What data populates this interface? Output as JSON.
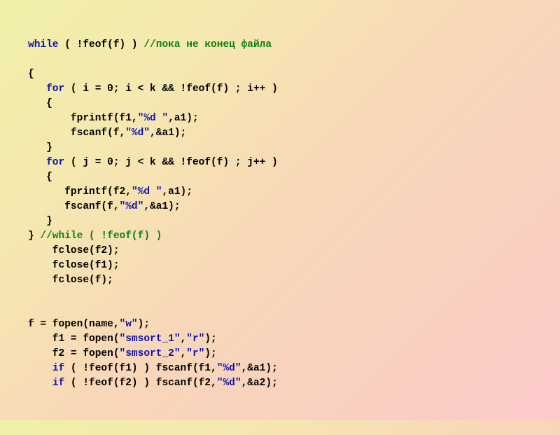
{
  "code_segments": [
    {
      "type": "kw",
      "text": "while"
    },
    {
      "type": "plain",
      "text": " ( !feof(f) ) "
    },
    {
      "type": "cmt",
      "text": "//пока не конец файла"
    },
    {
      "type": "plain",
      "text": "\n\n{\n   "
    },
    {
      "type": "kw",
      "text": "for"
    },
    {
      "type": "plain",
      "text": " ( i = 0; i < k && !feof(f) ; i++ )\n   {\n       fprintf(f1,"
    },
    {
      "type": "str",
      "text": "\"%d \""
    },
    {
      "type": "plain",
      "text": ",a1);\n       fscanf(f,"
    },
    {
      "type": "str",
      "text": "\"%d\""
    },
    {
      "type": "plain",
      "text": ",&a1);\n   }\n   "
    },
    {
      "type": "kw",
      "text": "for"
    },
    {
      "type": "plain",
      "text": " ( j = 0; j < k && !feof(f) ; j++ )\n   {\n      fprintf(f2,"
    },
    {
      "type": "str",
      "text": "\"%d \""
    },
    {
      "type": "plain",
      "text": ",a1);\n      fscanf(f,"
    },
    {
      "type": "str",
      "text": "\"%d\""
    },
    {
      "type": "plain",
      "text": ",&a1);\n   }\n} "
    },
    {
      "type": "cmt",
      "text": "//while ( !feof(f) )"
    },
    {
      "type": "plain",
      "text": "\n    fclose(f2);\n    fclose(f1);\n    fclose(f);\n\n\nf = fopen(name,"
    },
    {
      "type": "str",
      "text": "\"w\""
    },
    {
      "type": "plain",
      "text": ");\n    f1 = fopen("
    },
    {
      "type": "str",
      "text": "\"smsort_1\""
    },
    {
      "type": "plain",
      "text": ","
    },
    {
      "type": "str",
      "text": "\"r\""
    },
    {
      "type": "plain",
      "text": ");\n    f2 = fopen("
    },
    {
      "type": "str",
      "text": "\"smsort_2\""
    },
    {
      "type": "plain",
      "text": ","
    },
    {
      "type": "str",
      "text": "\"r\""
    },
    {
      "type": "plain",
      "text": ");\n    "
    },
    {
      "type": "kw",
      "text": "if"
    },
    {
      "type": "plain",
      "text": " ( !feof(f1) ) fscanf(f1,"
    },
    {
      "type": "str",
      "text": "\"%d\""
    },
    {
      "type": "plain",
      "text": ",&a1);\n    "
    },
    {
      "type": "kw",
      "text": "if"
    },
    {
      "type": "plain",
      "text": " ( !feof(f2) ) fscanf(f2,"
    },
    {
      "type": "str",
      "text": "\"%d\""
    },
    {
      "type": "plain",
      "text": ",&a2);"
    }
  ]
}
